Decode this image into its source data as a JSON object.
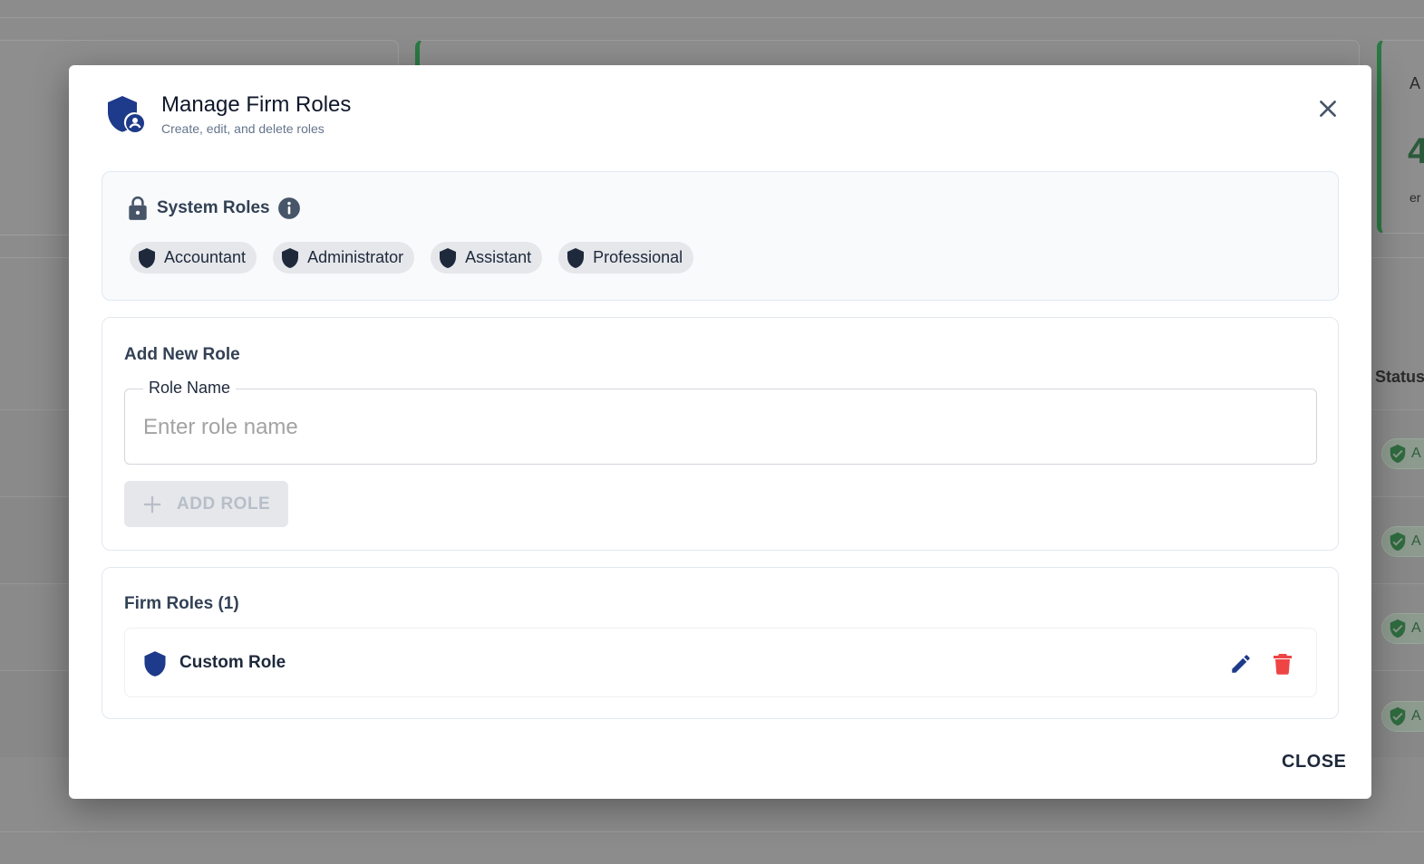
{
  "background": {
    "status_header": "Status",
    "card_letter": "A",
    "card_digit": "4",
    "card_subtext": "er",
    "badge_letter": "A"
  },
  "modal": {
    "title": "Manage Firm Roles",
    "subtitle": "Create, edit, and delete roles",
    "system_roles": {
      "title": "System Roles",
      "roles": [
        "Accountant",
        "Administrator",
        "Assistant",
        "Professional"
      ]
    },
    "add_role": {
      "title": "Add New Role",
      "field_label": "Role Name",
      "placeholder": "Enter role name",
      "value": "",
      "button_label": "ADD ROLE"
    },
    "firm_roles": {
      "title": "Firm Roles (1)",
      "roles": [
        {
          "name": "Custom Role"
        }
      ]
    },
    "close_label": "CLOSE"
  },
  "colors": {
    "primary": "#1e3a8a",
    "danger": "#ef4444",
    "success": "#2a7a43",
    "overlay": "#8c8c8c"
  }
}
